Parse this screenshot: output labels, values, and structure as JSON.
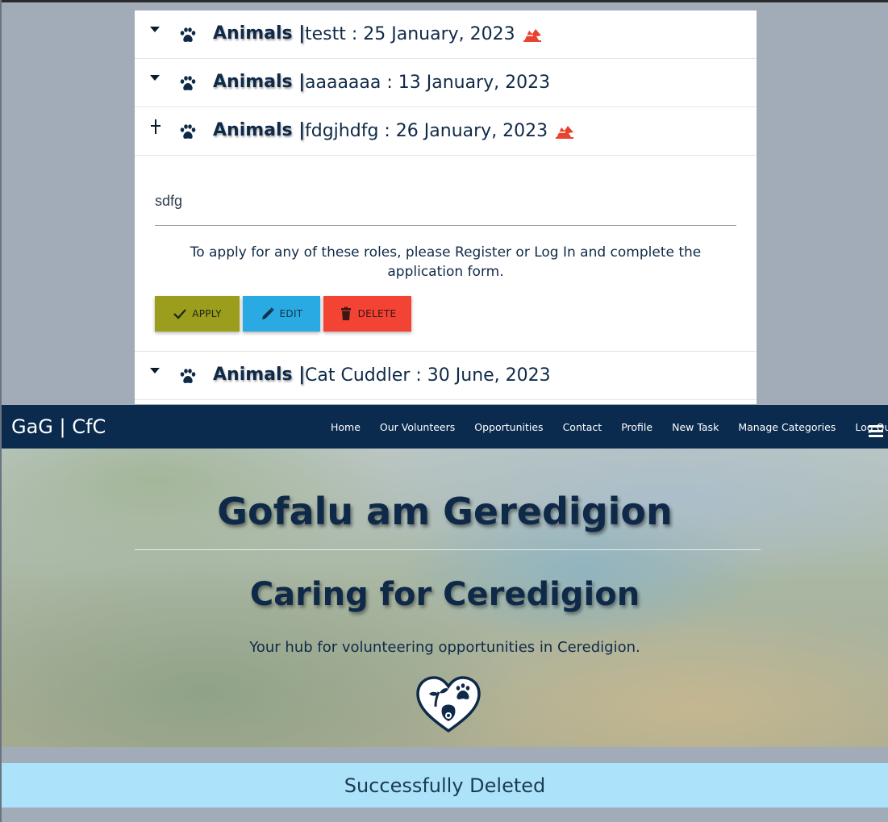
{
  "tasks": [
    {
      "category": "Animals |",
      "title": "testt : 25 January, 2023",
      "flagged": true,
      "expanded": false
    },
    {
      "category": "Animals |",
      "title": "aaaaaaa : 13 January, 2023",
      "flagged": false,
      "expanded": false
    },
    {
      "category": "Animals |",
      "title": "fdgjhdfg : 26 January, 2023",
      "flagged": true,
      "expanded": true
    },
    {
      "category": "Animals |",
      "title": "Cat Cuddler : 30 June, 2023",
      "flagged": false,
      "expanded": false
    }
  ],
  "expanded_task": {
    "description": "sdfg",
    "apply_note": "To apply for any of these roles, please Register or Log In and complete the application form.",
    "buttons": {
      "apply": "APPLY",
      "edit": "EDIT",
      "delete": "DELETE"
    }
  },
  "icons": {
    "collapsed": "caret-down-icon",
    "expanded": "plus-icon",
    "category": "paw-icon",
    "flag": "urgent-flag-icon"
  },
  "navbar": {
    "brand": "GaG | CfC",
    "links": [
      "Home",
      "Our Volunteers",
      "Opportunities",
      "Contact",
      "Profile",
      "New Task",
      "Manage Categories",
      "Log Out"
    ],
    "menu_icon": "hamburger-icon"
  },
  "hero": {
    "title": "Gofalu am Geredigion",
    "subtitle": "Caring for Ceredigion",
    "tagline": "Your hub for volunteering opportunities in Ceredigion.",
    "logo_icon": "heart-logo-icon"
  },
  "alert": {
    "message": "Successfully Deleted"
  },
  "colors": {
    "navy": "#0a2a4e",
    "apply": "#9b9d1c",
    "edit": "#2aaae2",
    "delete": "#f24334",
    "flag": "#e8432f",
    "alert_bg": "#ace3fa"
  }
}
